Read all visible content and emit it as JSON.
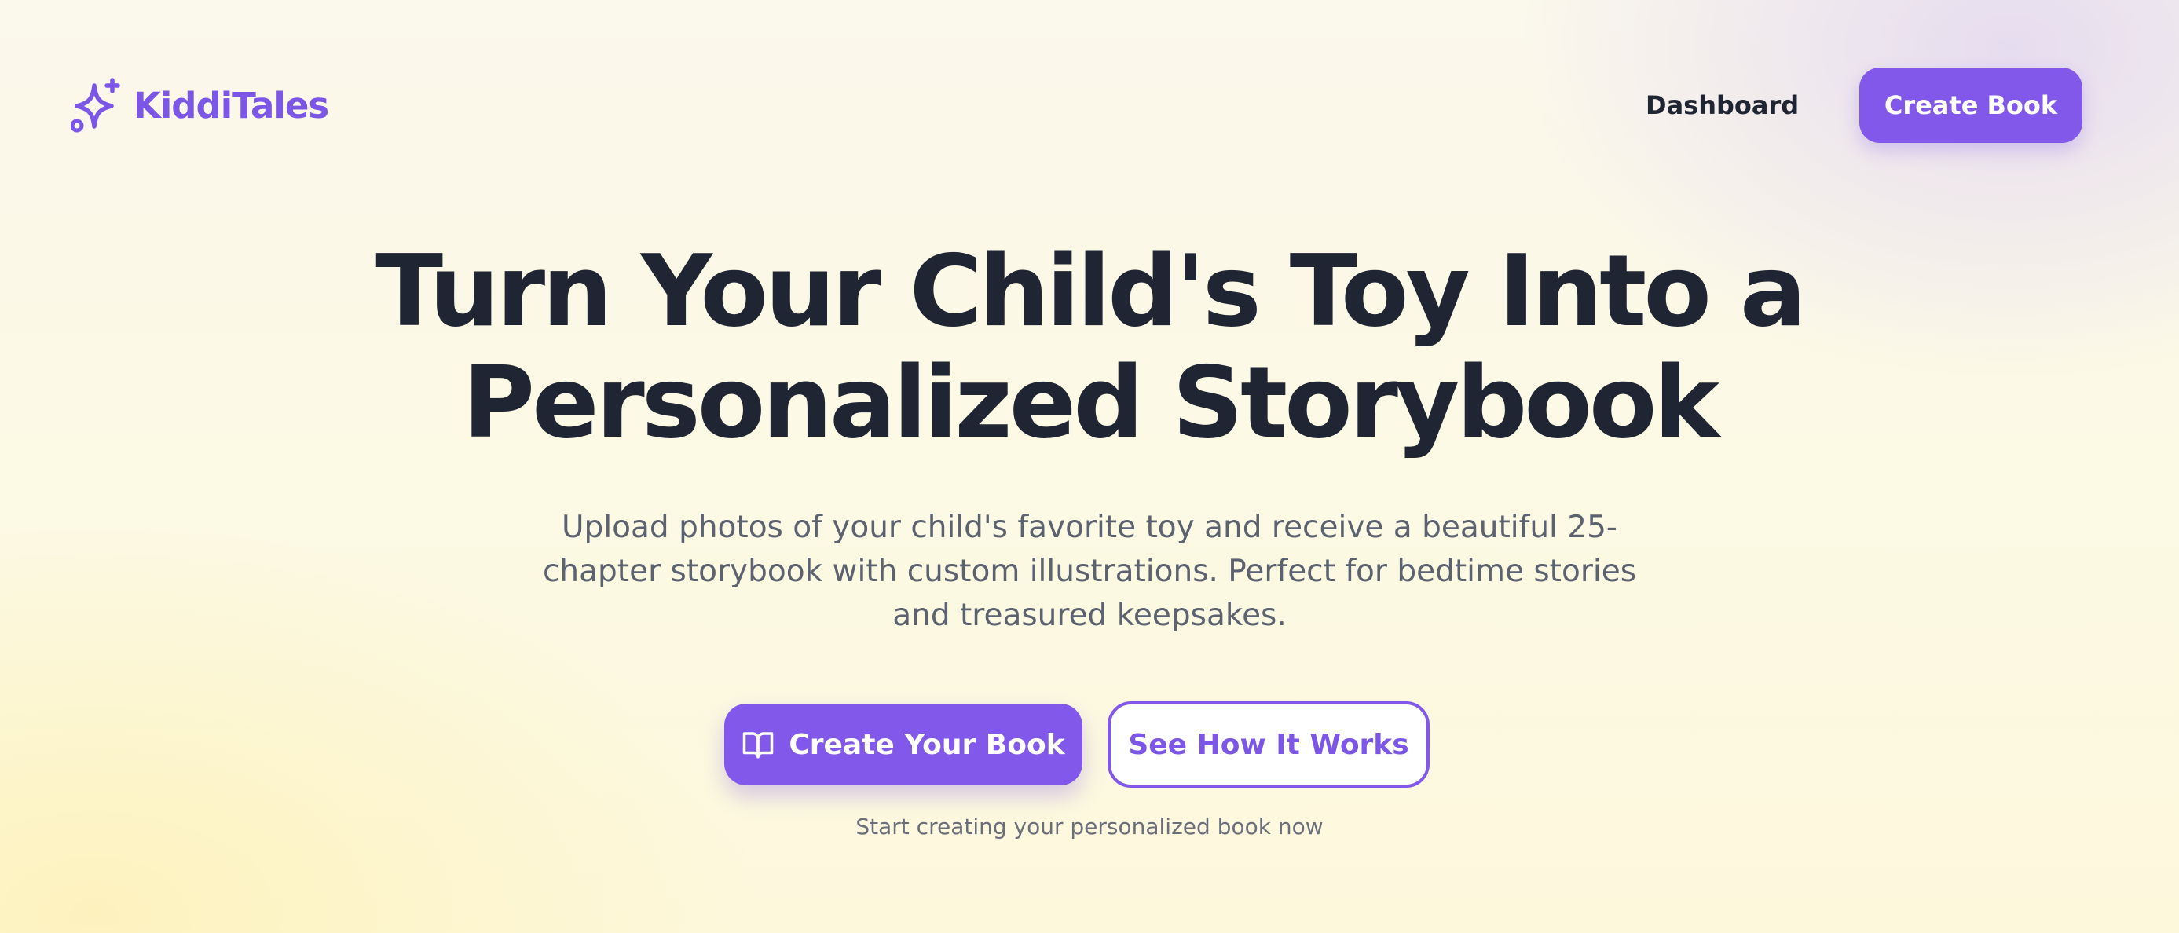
{
  "header": {
    "brand_name": "KiddiTales",
    "brand_icon": "sparkles-icon",
    "nav_dashboard": "Dashboard",
    "nav_create_book": "Create Book"
  },
  "hero": {
    "title_line1": "Turn Your Child's Toy Into a",
    "title_line2": "Personalized Storybook",
    "subtitle_line1": "Upload photos of your child's favorite toy and receive a beautiful 25-",
    "subtitle_line2": "chapter storybook with custom illustrations. Perfect for bedtime stories",
    "subtitle_line3": "and treasured keepsakes.",
    "primary_cta": "Create Your Book",
    "primary_cta_icon": "open-book-icon",
    "secondary_cta": "See How It Works",
    "cta_note": "Start creating your personalized book now"
  },
  "colors": {
    "accent": "#8158ea",
    "brand_text": "#7c56e6",
    "heading": "#1f2533",
    "body_text": "#5d6270"
  }
}
